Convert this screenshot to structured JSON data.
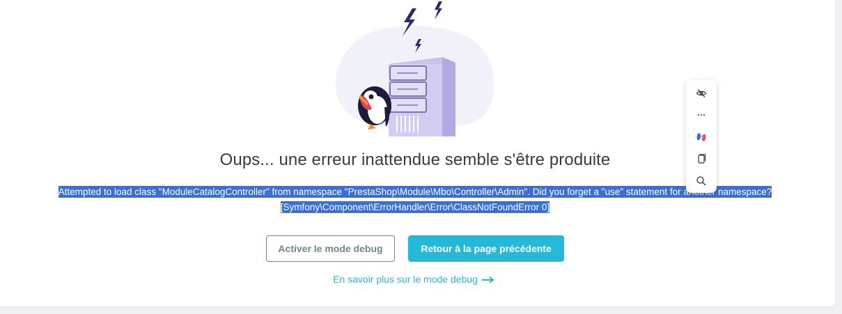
{
  "error_page": {
    "title": "Oups... une erreur inattendue semble s'être produite",
    "message_line1": "Attempted to load class \"ModuleCatalogController\" from namespace \"PrestaShop\\Module\\Mbo\\Controller\\Admin\". Did you forget a \"use\" statement for another namespace?",
    "message_line2": "[Symfony\\Component\\ErrorHandler\\Error\\ClassNotFoundError 0]",
    "debug_button_label": "Activer le mode debug",
    "back_button_label": "Retour à la page précédente",
    "learn_more_link": "En savoir plus sur le mode debug"
  },
  "floating_toolbar": {
    "items": [
      "eye-off-icon",
      "more-icon",
      "copilot-icon",
      "copy-icon",
      "search-icon"
    ]
  },
  "colors": {
    "primary": "#25b9d7",
    "outline": "#6c868e",
    "selection": "#3a6fd6",
    "title_text": "#363a41",
    "illustration_bg": "#f1f1f9",
    "server": "#c9c2ee"
  }
}
